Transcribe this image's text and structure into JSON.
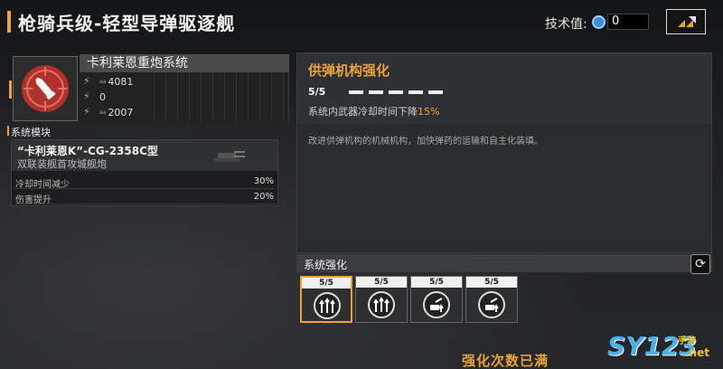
{
  "header": {
    "title": "枪骑兵级-轻型导弹驱逐舰",
    "tech_label": "技术值:",
    "tech_value": "0"
  },
  "weapon": {
    "name": "卡利莱恩重炮系统",
    "stats": [
      {
        "icon": "damage-icon",
        "prefix": "aa",
        "value": "4081"
      },
      {
        "icon": "attack-icon",
        "prefix": "",
        "value": "0"
      },
      {
        "icon": "defense-icon",
        "prefix": "aa",
        "value": "2007"
      }
    ]
  },
  "module": {
    "header": "系统模块",
    "name": "“卡利莱恩K”-CG-2358C型",
    "desc": "双联装舰首攻城舰炮",
    "rows": [
      {
        "label": "冷却时间减少",
        "value": "30%"
      },
      {
        "label": "伤害提升",
        "value": "20%"
      }
    ]
  },
  "upgrade": {
    "title": "供弹机构强化",
    "level": "5/5",
    "effect_prefix": "系统内武器冷却时间下降",
    "effect_value": "15%",
    "description": "改进供弹机构的机械机构，加快弹药的运输和自主化装填。"
  },
  "strengthen": {
    "label": "系统强化",
    "cards": [
      {
        "count": "5/5",
        "icon": "triple-arrow-icon",
        "selected": true
      },
      {
        "count": "5/5",
        "icon": "triple-arrow-icon",
        "selected": false
      },
      {
        "count": "5/5",
        "icon": "turret-up-icon",
        "selected": false
      },
      {
        "count": "5/5",
        "icon": "turret-up-icon",
        "selected": false
      }
    ],
    "status": "强化次数已满"
  },
  "watermark": {
    "brand": "SY123",
    "sub": "手游",
    "net": ".net"
  },
  "colors": {
    "accent": "#e8a33a",
    "background": "#1b1c1e"
  }
}
